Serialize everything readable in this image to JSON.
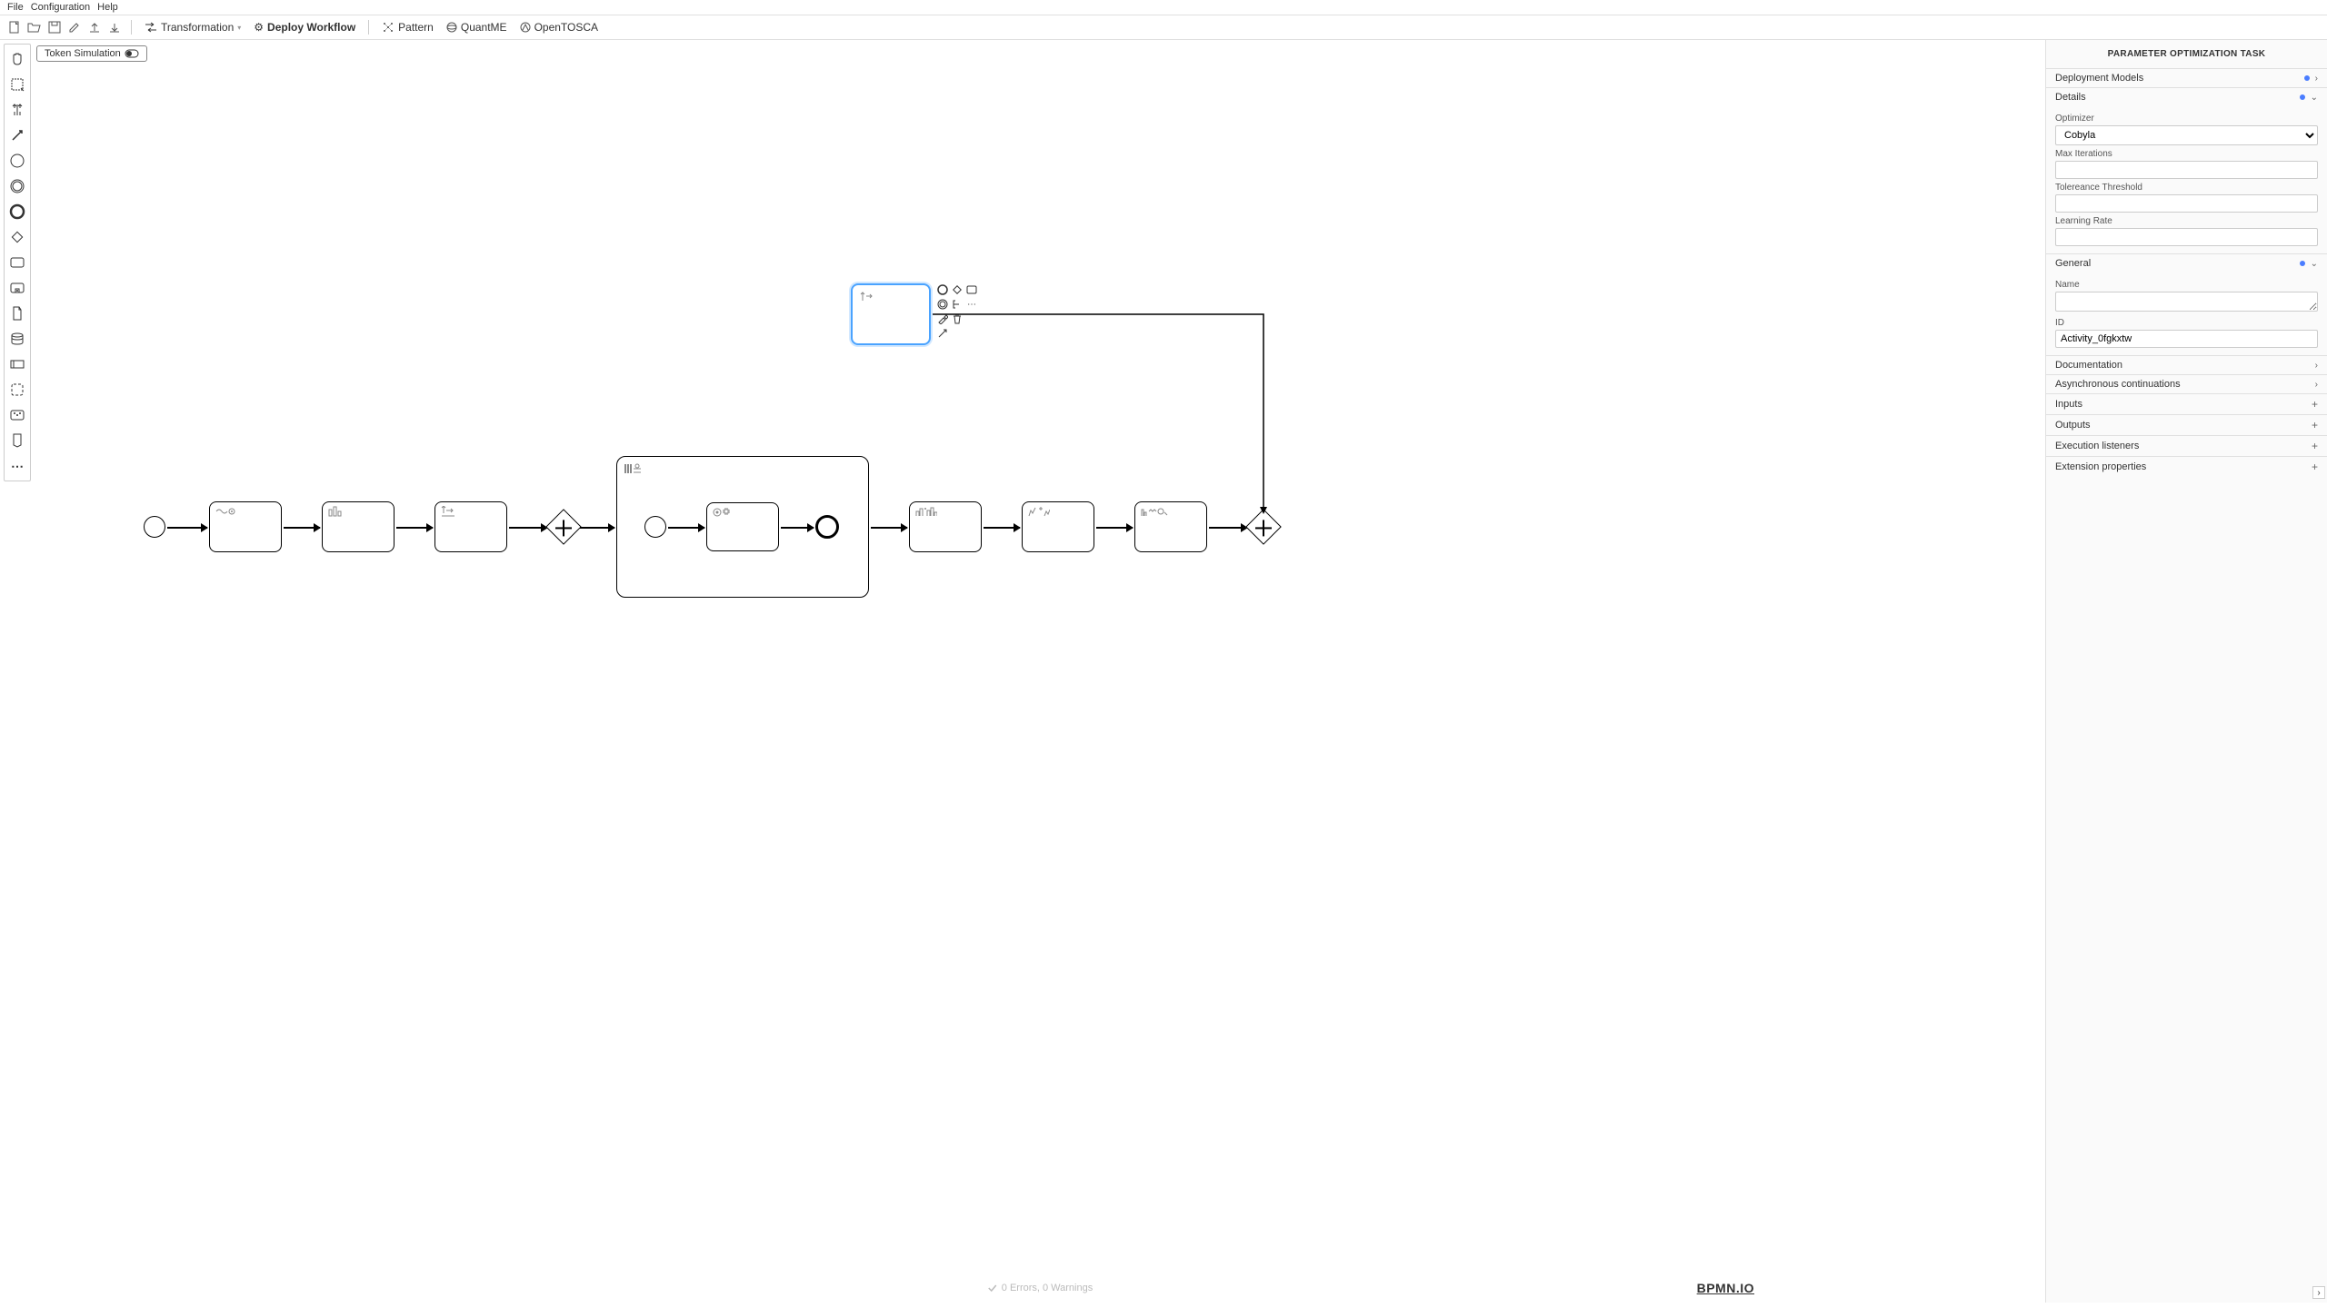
{
  "menu": {
    "file": "File",
    "configuration": "Configuration",
    "help": "Help"
  },
  "toolbar": {
    "transformation": "Transformation",
    "deploy_workflow": "Deploy Workflow",
    "pattern": "Pattern",
    "quantme": "QuantME",
    "opentosca": "OpenTOSCA"
  },
  "token_simulation": "Token Simulation",
  "props": {
    "title": "PARAMETER OPTIMIZATION TASK",
    "deployment_models": "Deployment Models",
    "details": "Details",
    "optimizer_label": "Optimizer",
    "optimizer_value": "Cobyla",
    "optimizer_options": [
      "Cobyla"
    ],
    "max_iterations_label": "Max Iterations",
    "max_iterations_value": "",
    "tolerance_label": "Tolereance Threshold",
    "tolerance_value": "",
    "learning_rate_label": "Learning Rate",
    "learning_rate_value": "",
    "general": "General",
    "name_label": "Name",
    "name_value": "",
    "id_label": "ID",
    "id_value": "Activity_0fgkxtw",
    "documentation": "Documentation",
    "async": "Asynchronous continuations",
    "inputs": "Inputs",
    "outputs": "Outputs",
    "exec_listeners": "Execution listeners",
    "ext_props": "Extension properties"
  },
  "status": "0 Errors, 0 Warnings",
  "logo": "BPMN.IO"
}
